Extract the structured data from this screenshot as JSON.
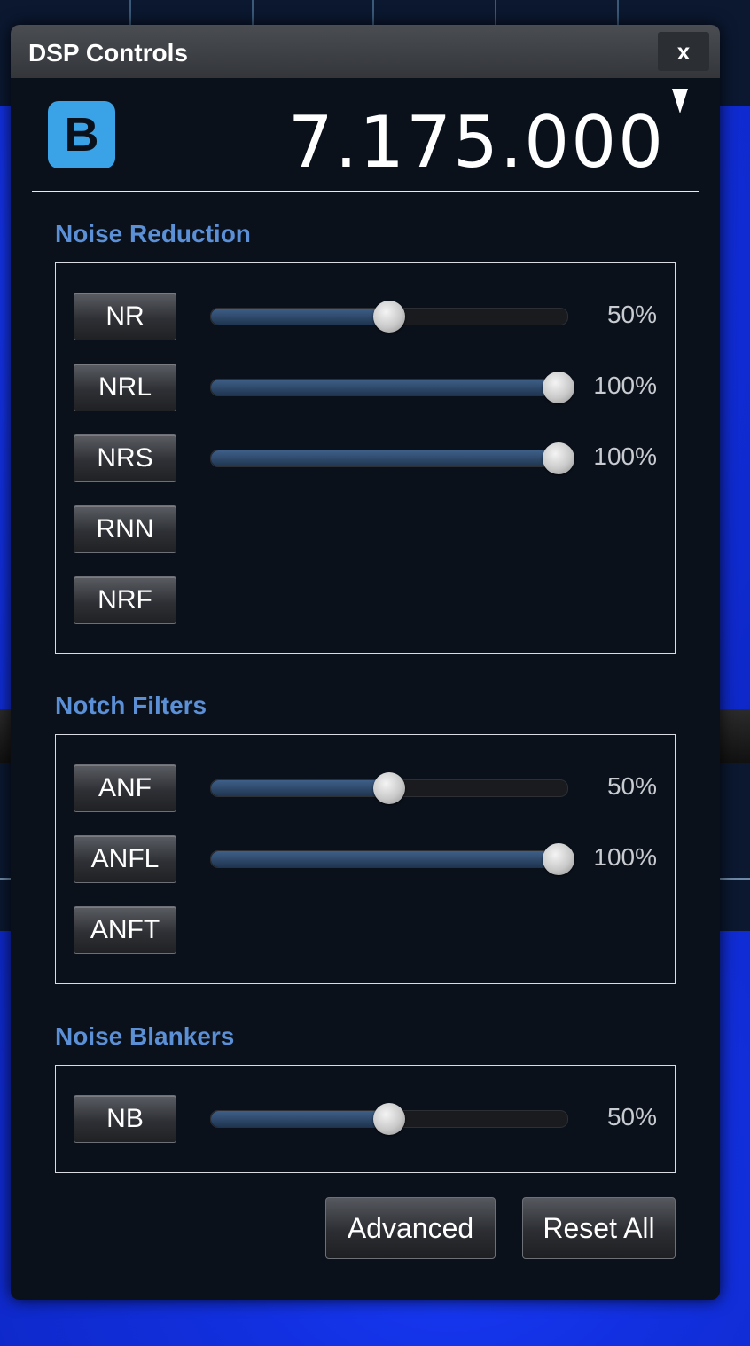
{
  "window": {
    "title": "DSP Controls",
    "close_label": "x"
  },
  "header": {
    "vfo_badge": "B",
    "frequency": "7.175.000"
  },
  "sections": {
    "noise_reduction": {
      "title": "Noise Reduction",
      "controls": [
        {
          "label": "NR",
          "has_slider": true,
          "level": 0.5,
          "value_text": "50%"
        },
        {
          "label": "NRL",
          "has_slider": true,
          "level": 1.0,
          "value_text": "100%"
        },
        {
          "label": "NRS",
          "has_slider": true,
          "level": 1.0,
          "value_text": "100%"
        },
        {
          "label": "RNN",
          "has_slider": false
        },
        {
          "label": "NRF",
          "has_slider": false
        }
      ]
    },
    "notch_filters": {
      "title": "Notch Filters",
      "controls": [
        {
          "label": "ANF",
          "has_slider": true,
          "level": 0.5,
          "value_text": "50%"
        },
        {
          "label": "ANFL",
          "has_slider": true,
          "level": 1.0,
          "value_text": "100%"
        },
        {
          "label": "ANFT",
          "has_slider": false
        }
      ]
    },
    "noise_blankers": {
      "title": "Noise Blankers",
      "controls": [
        {
          "label": "NB",
          "has_slider": true,
          "level": 0.5,
          "value_text": "50%"
        }
      ]
    }
  },
  "footer": {
    "advanced_label": "Advanced",
    "reset_label": "Reset All"
  },
  "colors": {
    "accent": "#5b8fd6",
    "badge": "#3aa3e8",
    "panel": "#0a111b"
  }
}
